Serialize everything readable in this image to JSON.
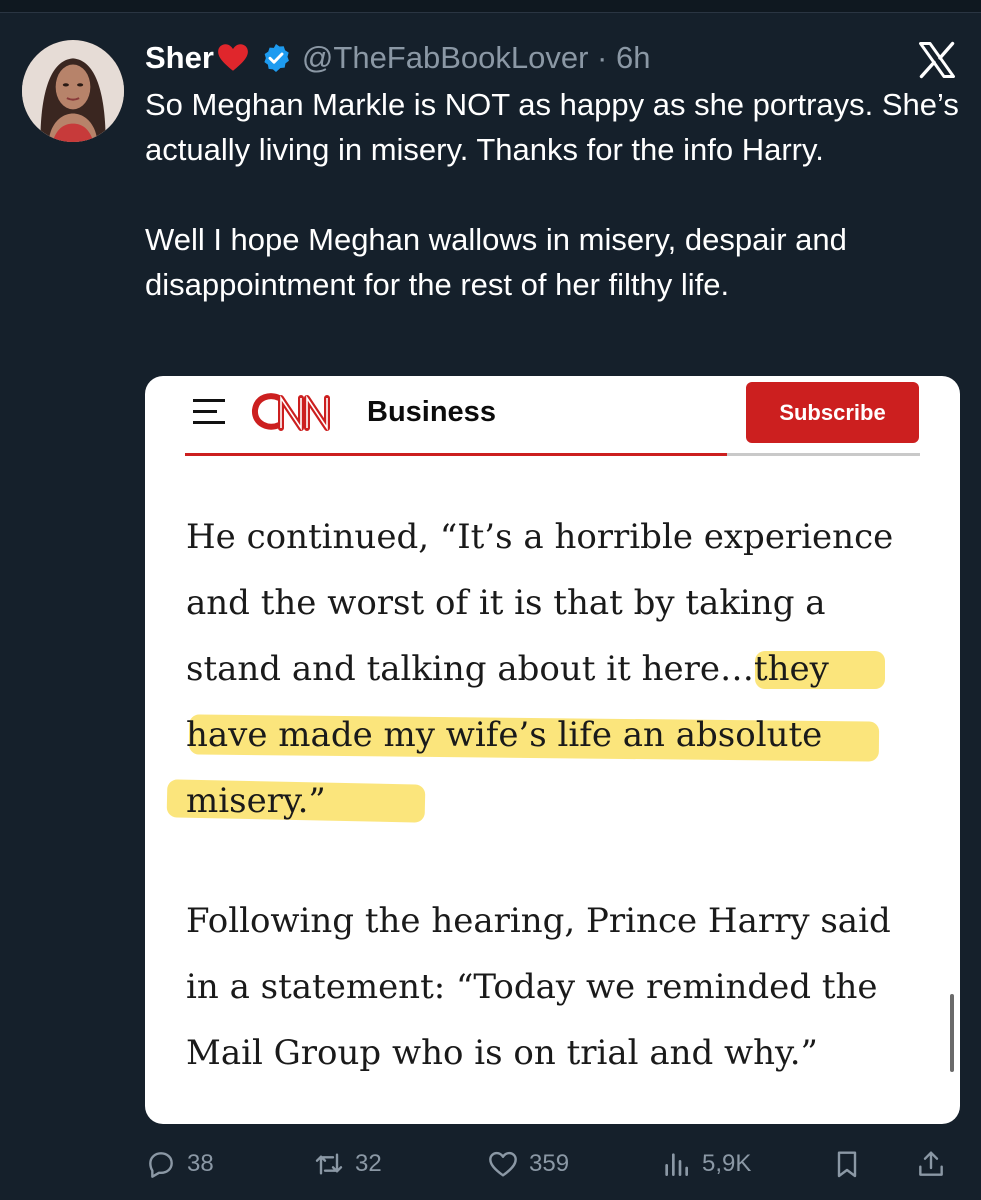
{
  "tweet": {
    "author_name": "Sher",
    "handle_time": "@TheFabBookLover · 6h",
    "text": "So Meghan Markle is NOT as happy as she portrays. She’s actually living in misery. Thanks for the info Harry.\n\nWell I hope Meghan wallows in misery, despair and disappointment for the rest of her filthy life."
  },
  "card": {
    "section": "Business",
    "subscribe_label": "Subscribe",
    "lines_p1": [
      "He continued, “It’s a horrible experience",
      "and the worst of it is that by taking a",
      "stand and talking about it here…they",
      "have made my wife’s life an absolute",
      "misery.”"
    ],
    "lines_p2": [
      "Following the hearing, Prince Harry said",
      "in a statement: “Today we reminded the",
      "Mail Group who is on trial and why.”"
    ]
  },
  "actions": {
    "replies": "38",
    "reposts": "32",
    "likes": "359",
    "views": "5,9K"
  },
  "icons": [
    "heart-emoji-icon",
    "verified-badge-icon",
    "x-logo-icon",
    "menu-icon",
    "cnn-logo-icon",
    "reply-icon",
    "repost-icon",
    "like-icon",
    "views-icon",
    "bookmark-icon",
    "share-icon"
  ],
  "colors": {
    "background": "#15202b",
    "verified": "#1d9bf0",
    "cnn_red": "#cc1f1f",
    "highlight": "#fadc50",
    "muted": "#8b98a5"
  }
}
